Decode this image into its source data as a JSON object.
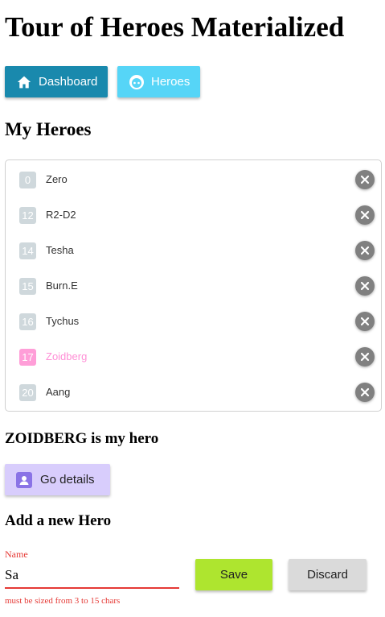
{
  "app_title": "Tour of Heroes Materialized",
  "nav": {
    "dashboard_label": "Dashboard",
    "heroes_label": "Heroes"
  },
  "heroes_section": {
    "title": "My Heroes",
    "heroes": [
      {
        "id": "0",
        "name": "Zero"
      },
      {
        "id": "12",
        "name": "R2-D2"
      },
      {
        "id": "14",
        "name": "Tesha"
      },
      {
        "id": "15",
        "name": "Burn.E"
      },
      {
        "id": "16",
        "name": "Tychus"
      },
      {
        "id": "17",
        "name": "Zoidberg"
      },
      {
        "id": "20",
        "name": "Aang"
      }
    ],
    "selected_index": 5
  },
  "selected_hero": {
    "message": "ZOIDBERG is my hero",
    "details_label": "Go details"
  },
  "add_hero": {
    "title": "Add a new Hero",
    "name_label": "Name",
    "name_value": "Sa",
    "error": "must be sized from 3 to 15 chars",
    "save_label": "Save",
    "discard_label": "Discard"
  },
  "colors": {
    "dashboard_button": "#1989ad",
    "heroes_button": "#56d5f7",
    "selected_hero": "#ff9ed8",
    "details_button": "#d8cdfc",
    "save_button": "#aee52f",
    "discard_button": "#dadada",
    "error": "#e53935"
  }
}
